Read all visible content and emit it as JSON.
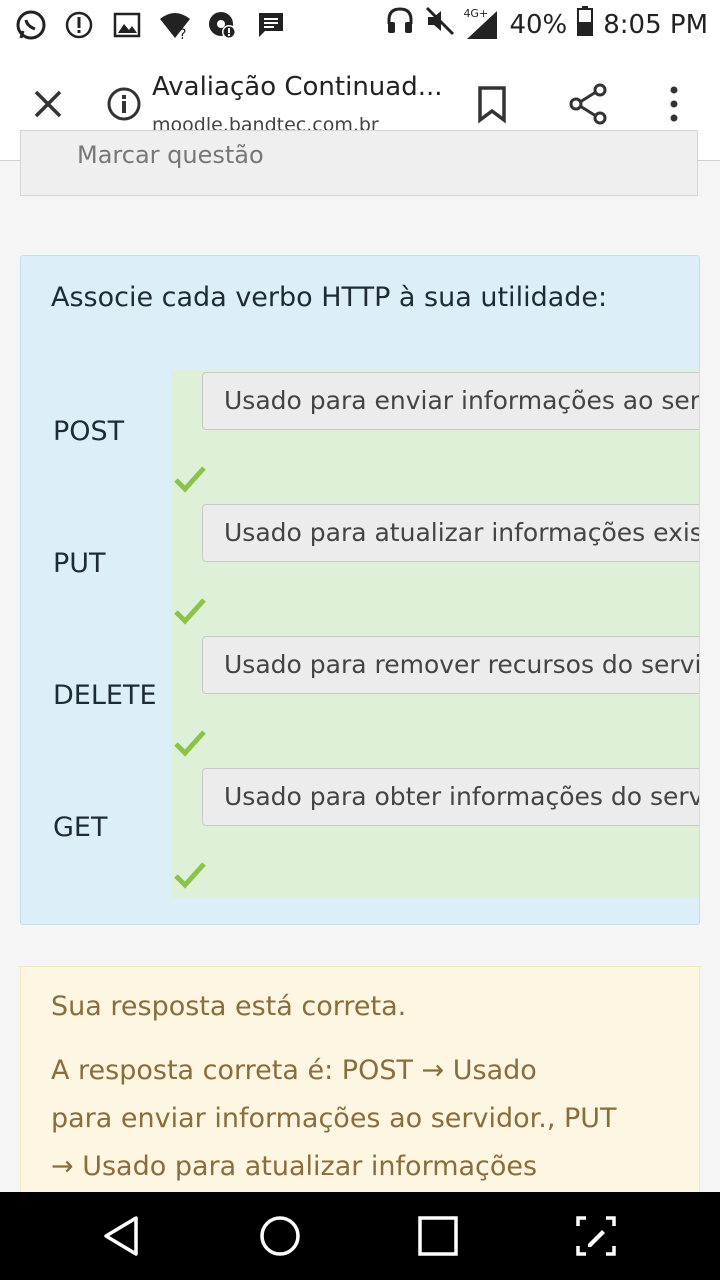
{
  "status_bar": {
    "battery": "40%",
    "time": "8:05 PM",
    "network": "4G+",
    "left_icons": [
      "whatsapp-icon",
      "alert-icon",
      "image-icon",
      "wifi-question-icon",
      "chrome-alert-icon",
      "message-icon"
    ],
    "right_icons": [
      "headset-icon",
      "mute-icon",
      "signal-icon",
      "battery-icon"
    ]
  },
  "browser": {
    "page_title": "Avaliação Continuad...",
    "url": "moodle.bandtec.com.br"
  },
  "flag": {
    "label": "Marcar questão"
  },
  "question": {
    "text": "Associe cada verbo HTTP à sua utilidade:",
    "rows": [
      {
        "verb": "POST",
        "answer": "Usado para enviar informações ao servidor."
      },
      {
        "verb": "PUT",
        "answer": "Usado para atualizar informações existentes."
      },
      {
        "verb": "DELETE",
        "answer": "Usado para remover recursos do servidor."
      },
      {
        "verb": "GET",
        "answer": "Usado para obter informações do servidor."
      }
    ]
  },
  "feedback": {
    "status": "Sua resposta está correta.",
    "line1": "A resposta correta é: POST → Usado",
    "line2": "para enviar informações ao servidor., PUT",
    "line3": "→ Usado para atualizar informações"
  },
  "colors": {
    "question_bg": "#dceef7",
    "answer_bg": "#dff0d8",
    "check": "#8bc34a",
    "feedback_bg": "#fcf6e3",
    "feedback_text": "#8a6d3b"
  }
}
